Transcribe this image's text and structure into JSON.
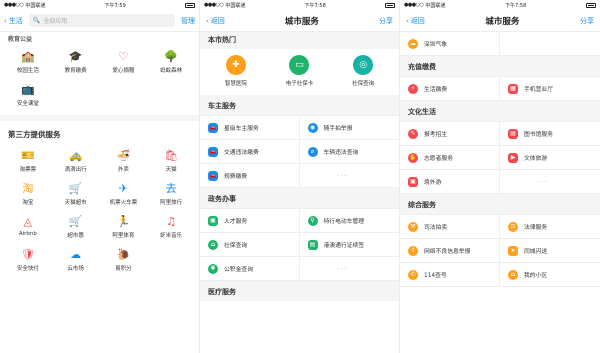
{
  "status": {
    "carrier": "中国联通",
    "time1": "下午7:59",
    "time2": "下午7:58",
    "time3": "下午7:58"
  },
  "screen1": {
    "search_placeholder": "全部应用",
    "manage_label": "管理",
    "top_cut_title": "教育公益",
    "edu_items": [
      {
        "label": "校园生活",
        "icon": "school-icon"
      },
      {
        "label": "教育缴费",
        "icon": "graduation-icon"
      },
      {
        "label": "爱心捐赠",
        "icon": "heart-icon"
      },
      {
        "label": "蚂蚁森林",
        "icon": "tree-icon"
      },
      {
        "label": "安全课堂",
        "icon": "tv-icon"
      }
    ],
    "third_party_title": "第三方提供服务",
    "third_items": [
      {
        "label": "淘票票",
        "icon": "ticket-icon"
      },
      {
        "label": "滴滴出行",
        "icon": "car-icon"
      },
      {
        "label": "外卖",
        "icon": "bowl-icon"
      },
      {
        "label": "天猫",
        "icon": "cat-icon"
      },
      {
        "label": "淘宝",
        "icon": "taobao-icon"
      },
      {
        "label": "天猫超市",
        "icon": "cart-icon"
      },
      {
        "label": "机票火车票",
        "icon": "plane-icon"
      },
      {
        "label": "阿里旅行",
        "icon": "travel-icon"
      },
      {
        "label": "Airbnb",
        "icon": "airbnb-icon"
      },
      {
        "label": "超市惠",
        "icon": "shopcart-icon"
      },
      {
        "label": "阿里体育",
        "icon": "runner-icon"
      },
      {
        "label": "虾米音乐",
        "icon": "music-icon"
      },
      {
        "label": "安全快付",
        "icon": "shield-icon"
      },
      {
        "label": "云市场",
        "icon": "cloud-icon"
      },
      {
        "label": "易积分",
        "icon": "snail-icon"
      }
    ]
  },
  "screen2": {
    "back_label": "返回",
    "title": "城市服务",
    "share_label": "分享",
    "hot_title": "本市热门",
    "hot_items": [
      {
        "label": "智慧医院",
        "icon": "hospital-icon"
      },
      {
        "label": "电子社保卡",
        "icon": "card-icon"
      },
      {
        "label": "社保查询",
        "icon": "security-icon"
      }
    ],
    "car_title": "车主服务",
    "car_items": [
      {
        "label": "星级车主服务",
        "icon": "car-icon"
      },
      {
        "label": "随手拍举报",
        "icon": "camera-icon"
      },
      {
        "label": "交通违法缴费",
        "icon": "car-icon"
      },
      {
        "label": "车辆违法查询",
        "icon": "search-icon"
      },
      {
        "label": "规费缴费",
        "icon": "car-icon"
      }
    ],
    "gov_title": "政务办事",
    "gov_items": [
      {
        "label": "人才服务",
        "icon": "id-icon"
      },
      {
        "label": "特行电动车管理",
        "icon": "bike-icon"
      },
      {
        "label": "社保查询",
        "icon": "security-icon"
      },
      {
        "label": "港澳通行证续签",
        "icon": "passport-icon"
      },
      {
        "label": "公积金查询",
        "icon": "fund-icon"
      }
    ],
    "medical_title": "医疗服务"
  },
  "screen3": {
    "back_label": "返回",
    "title": "城市服务",
    "share_label": "分享",
    "weather_label": "深圳气象",
    "recharge_title": "充值缴费",
    "recharge_items": [
      {
        "label": "生活缴费",
        "icon": "utility-icon"
      },
      {
        "label": "手机营业厅",
        "icon": "shop-icon"
      }
    ],
    "culture_title": "文化生活",
    "culture_items": [
      {
        "label": "报考招生",
        "icon": "exam-icon"
      },
      {
        "label": "图书馆服务",
        "icon": "book-icon"
      },
      {
        "label": "志愿者服务",
        "icon": "hand-icon"
      },
      {
        "label": "文体旅游",
        "icon": "film-icon"
      },
      {
        "label": "境外游",
        "icon": "luggage-icon"
      }
    ],
    "general_title": "综合服务",
    "general_items": [
      {
        "label": "司法拍卖",
        "icon": "gavel-icon"
      },
      {
        "label": "法律服务",
        "icon": "law-icon"
      },
      {
        "label": "网络不良信息举报",
        "icon": "report-icon"
      },
      {
        "label": "同城闪送",
        "icon": "delivery-icon"
      },
      {
        "label": "114查号",
        "icon": "phone-icon"
      },
      {
        "label": "我的小区",
        "icon": "home-icon"
      }
    ]
  }
}
